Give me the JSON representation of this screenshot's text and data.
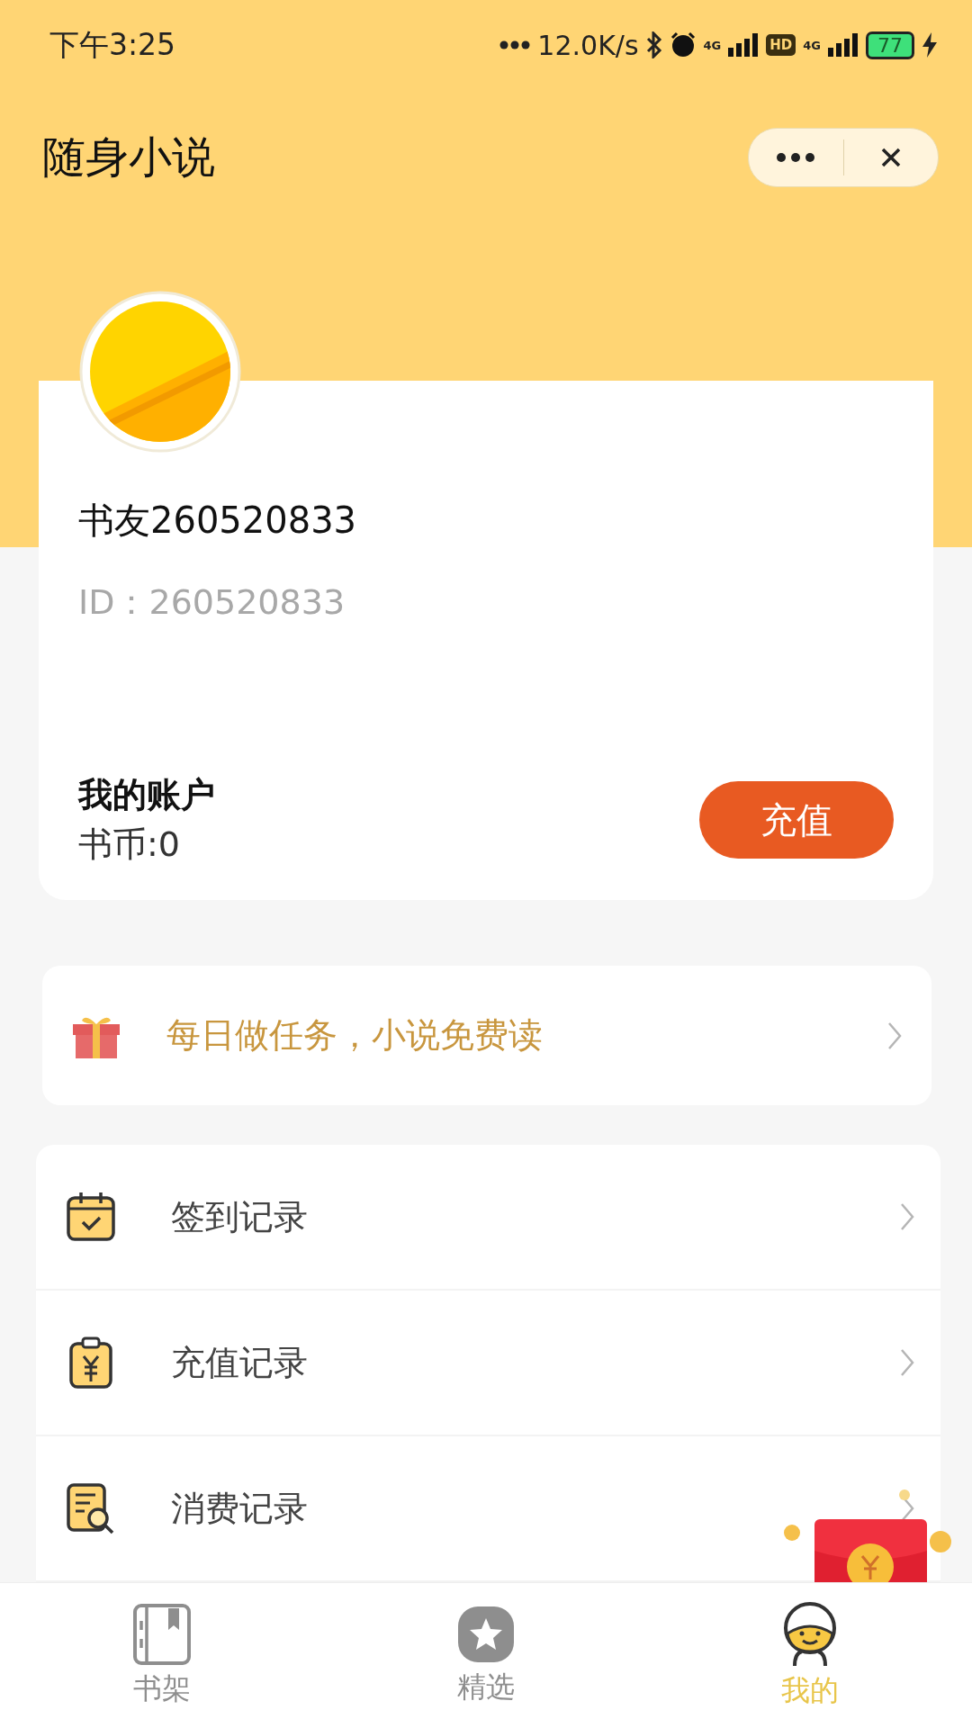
{
  "status_bar": {
    "time": "下午3:25",
    "speed": "12.0K/s",
    "sim1": "4G",
    "hd": "HD",
    "sim2": "4G",
    "battery": "77"
  },
  "header": {
    "title": "随身小说"
  },
  "profile": {
    "name": "书友260520833",
    "id": "ID：260520833",
    "account_label": "我的账户",
    "coins": "书币:0",
    "recharge_button": "充值"
  },
  "task_banner": {
    "text": "每日做任务，小说免费读"
  },
  "menu": [
    {
      "kind": "checkin",
      "label": "签到记录"
    },
    {
      "kind": "recharge",
      "label": "充值记录"
    },
    {
      "kind": "spending",
      "label": "消费记录"
    }
  ],
  "tabs": [
    {
      "kind": "shelf",
      "label": "书架",
      "selected": false
    },
    {
      "kind": "star",
      "label": "精选",
      "selected": false
    },
    {
      "kind": "mascot",
      "label": "我的",
      "selected": true
    }
  ]
}
